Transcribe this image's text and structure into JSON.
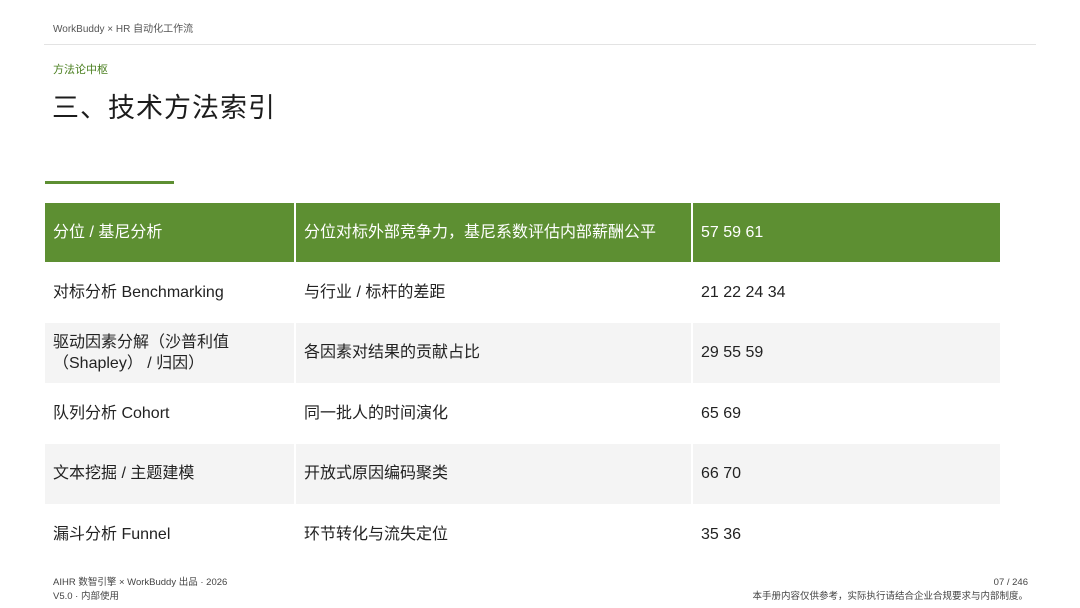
{
  "header": {
    "running_title": "WorkBuddy × HR 自动化工作流"
  },
  "section": {
    "eyebrow": "方法论中枢",
    "title": "三、技术方法索引"
  },
  "table": {
    "header_row": [
      "分位 / 基尼分析",
      "分位对标外部竞争力，基尼系数评估内部薪酬公平",
      "57 59 61"
    ],
    "rows": [
      [
        "对标分析 Benchmarking",
        "与行业 / 标杆的差距",
        "21 22 24 34"
      ],
      [
        "驱动因素分解（沙普利值（Shapley） / 归因）",
        "各因素对结果的贡献占比",
        "29 55 59"
      ],
      [
        "队列分析 Cohort",
        "同一批人的时间演化",
        "65 69"
      ],
      [
        "文本挖掘 / 主题建模",
        "开放式原因编码聚类",
        "66 70"
      ],
      [
        "漏斗分析 Funnel",
        "环节转化与流失定位",
        "35 36"
      ]
    ]
  },
  "footer": {
    "left_line1": "AIHR 数智引擎 × WorkBuddy 出品 · 2026",
    "left_line2": "V5.0 · 内部使用",
    "page_number": "07 / 246",
    "disclaimer": "本手册内容仅供参考，实际执行请结合企业合规要求与内部制度。"
  },
  "colors": {
    "accent": "#5d8f32",
    "eyebrow": "#4a7f1f",
    "row_shade": "#f4f4f4"
  }
}
